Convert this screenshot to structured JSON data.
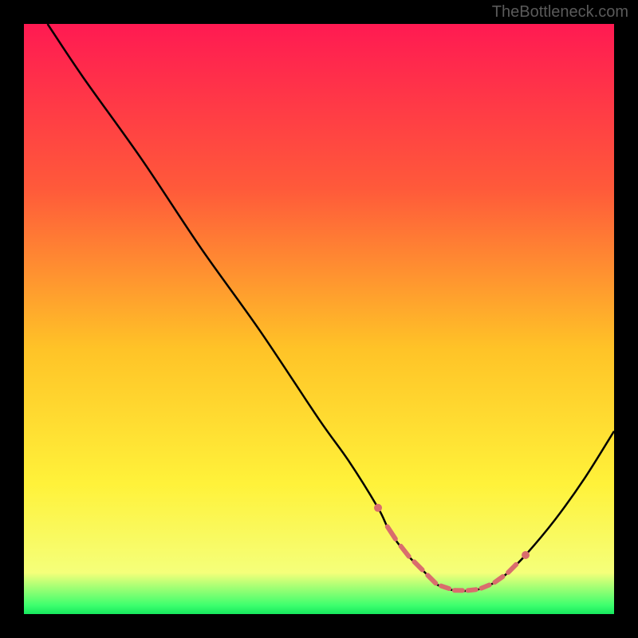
{
  "watermark": "TheBottleneck.com",
  "chart_data": {
    "type": "line",
    "title": "",
    "xlabel": "",
    "ylabel": "",
    "xlim": [
      0,
      100
    ],
    "ylim": [
      0,
      100
    ],
    "series": [
      {
        "name": "curve",
        "x": [
          4,
          10,
          20,
          30,
          40,
          50,
          55,
          60,
          62,
          65,
          68,
          70,
          73,
          76,
          78,
          80,
          82,
          85,
          90,
          95,
          100
        ],
        "values": [
          100,
          91,
          77,
          62,
          48,
          33,
          26,
          18,
          14,
          10,
          7,
          5,
          4,
          4,
          4.5,
          5.5,
          7,
          10,
          16,
          23,
          31
        ]
      }
    ],
    "highlight_region": {
      "x_start": 60,
      "x_end": 85,
      "color": "#d96d6d"
    },
    "gradient_stops": [
      {
        "offset": 0.0,
        "color": "#ff1a52"
      },
      {
        "offset": 0.28,
        "color": "#ff5a3a"
      },
      {
        "offset": 0.55,
        "color": "#ffc327"
      },
      {
        "offset": 0.78,
        "color": "#fff23a"
      },
      {
        "offset": 0.93,
        "color": "#f5ff7a"
      },
      {
        "offset": 0.985,
        "color": "#3eff6e"
      },
      {
        "offset": 1.0,
        "color": "#16e85e"
      }
    ],
    "curve_stroke": "#000000",
    "dots_stroke": "#d96d6d"
  }
}
